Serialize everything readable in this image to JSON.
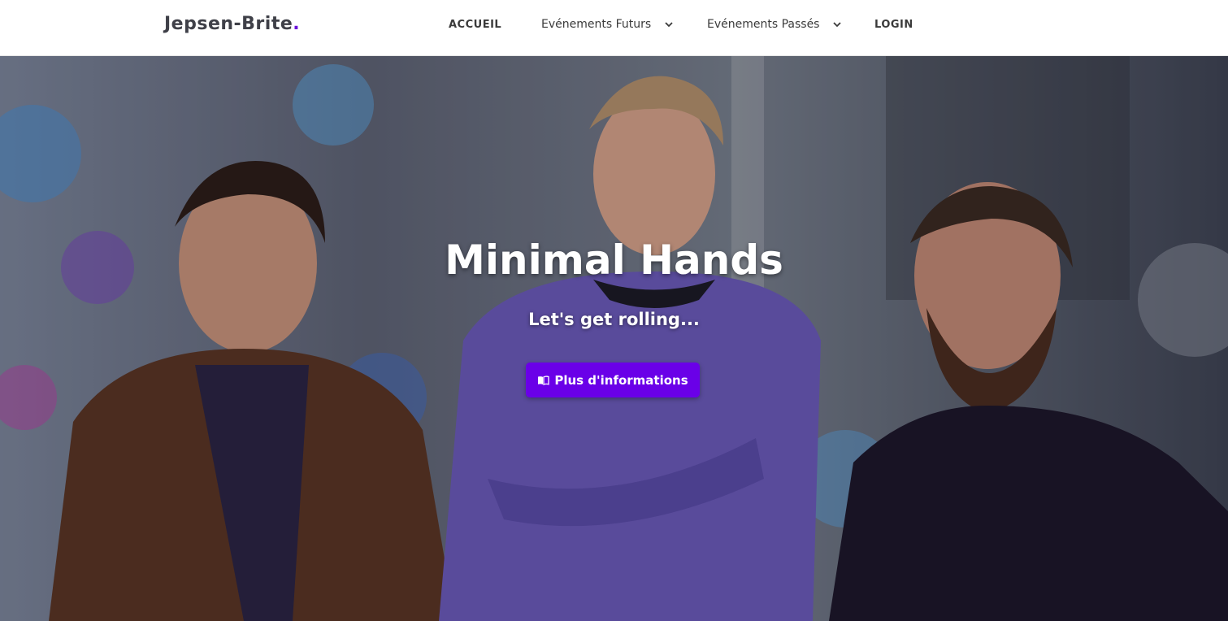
{
  "nav": {
    "brand": "Jepsen-Brite",
    "brand_dot": ".",
    "items": [
      {
        "label": "ACCUEIL"
      },
      {
        "label": "Evénements Futurs"
      },
      {
        "label": "Evénements Passés"
      },
      {
        "label": "LOGIN"
      }
    ]
  },
  "hero": {
    "title": "Minimal Hands",
    "subtitle": "Let's get rolling...",
    "button_label": "Plus d'informations",
    "button_icon": "book-open-icon"
  },
  "colors": {
    "brand_accent": "#6a11d9",
    "button_bg": "#6a00e8",
    "nav_text": "#3a3a3a"
  }
}
